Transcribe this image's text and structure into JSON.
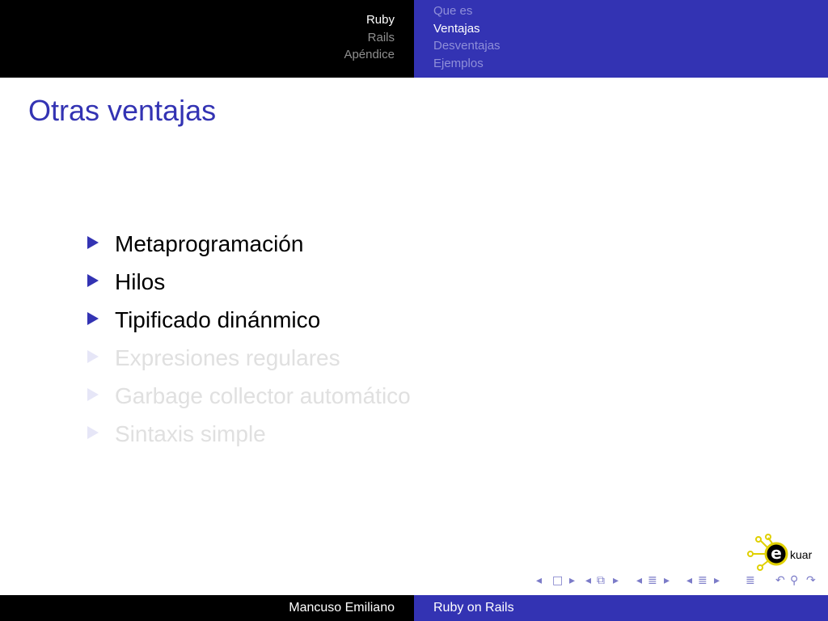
{
  "header": {
    "sections": [
      {
        "label": "Ruby",
        "active": true
      },
      {
        "label": "Rails",
        "active": false
      },
      {
        "label": "Apéndice",
        "active": false
      }
    ],
    "subsections": [
      {
        "label": "Que es",
        "active": false
      },
      {
        "label": "Ventajas",
        "active": true
      },
      {
        "label": "Desventajas",
        "active": false
      },
      {
        "label": "Ejemplos",
        "active": false
      }
    ]
  },
  "slide": {
    "title": "Otras ventajas",
    "items": [
      {
        "text": "Metaprogramación",
        "shown": true
      },
      {
        "text": "Hilos",
        "shown": true
      },
      {
        "text": "Tipificado dinánmico",
        "shown": true
      },
      {
        "text": "Expresiones regulares",
        "shown": false
      },
      {
        "text": "Garbage collector automático",
        "shown": false
      },
      {
        "text": "Sintaxis simple",
        "shown": false
      }
    ]
  },
  "footer": {
    "author": "Mancuso Emiliano",
    "talk_title": "Ruby on Rails"
  },
  "logo": {
    "letter": "e",
    "text": "kuar"
  },
  "colors": {
    "accent": "#3333b3",
    "header_bg": "#000000"
  },
  "nav_icons": [
    "nav-first-frame-icon",
    "nav-frame-icon",
    "nav-prev-section-icon",
    "nav-subsection-icon",
    "nav-next-icon",
    "nav-document-icon",
    "nav-search-icon"
  ]
}
